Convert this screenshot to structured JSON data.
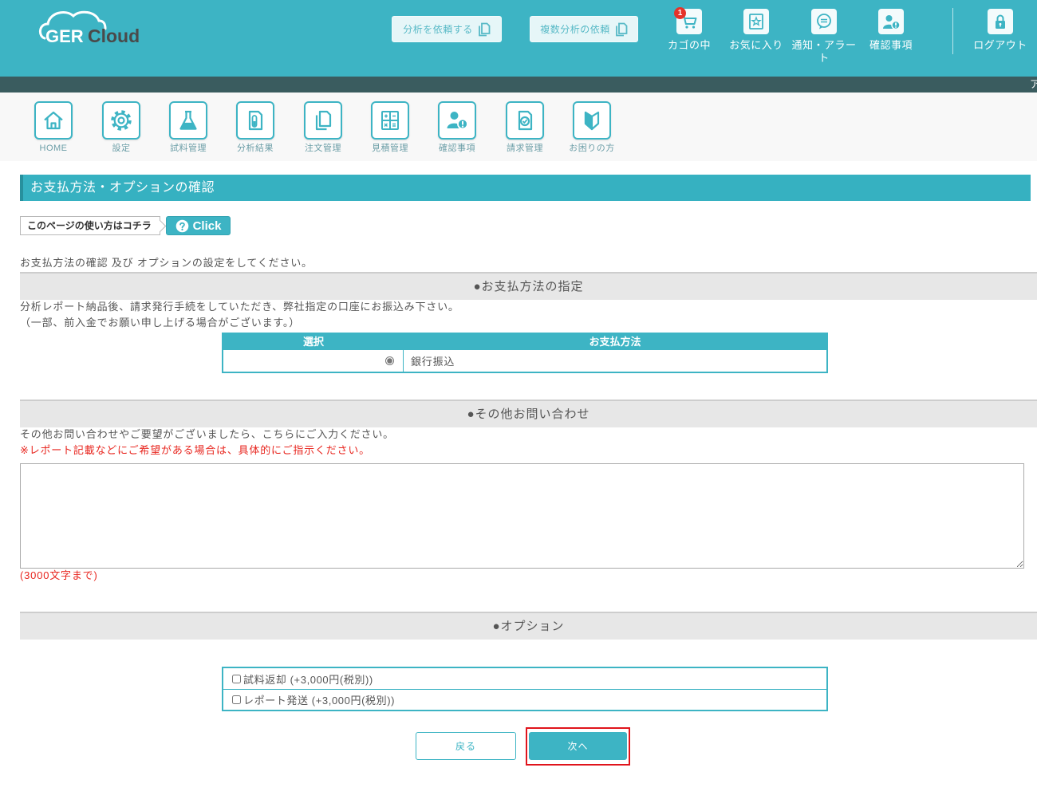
{
  "header": {
    "logo": {
      "part1": "GER",
      "part2": "Cloud"
    },
    "request_button": "分析を依頼する",
    "multi_request_button": "複数分析の依頼",
    "nav": [
      {
        "label": "カゴの中",
        "icon": "cart-icon",
        "badge": "1"
      },
      {
        "label": "お気に入り",
        "icon": "favorite-icon"
      },
      {
        "label": "通知・アラート",
        "icon": "notification-icon"
      },
      {
        "label": "確認事項",
        "icon": "confirm-person-icon"
      }
    ],
    "logout": {
      "label": "ログアウト",
      "icon": "lock-icon"
    }
  },
  "ticker": {
    "text": "ア"
  },
  "menu": [
    {
      "label": "HOME",
      "icon": "home-icon"
    },
    {
      "label": "設定",
      "icon": "gear-icon"
    },
    {
      "label": "試料管理",
      "icon": "flask-icon"
    },
    {
      "label": "分析結果",
      "icon": "test-tube-document-icon"
    },
    {
      "label": "注文管理",
      "icon": "documents-icon"
    },
    {
      "label": "見積管理",
      "icon": "calculator-icon"
    },
    {
      "label": "確認事項",
      "icon": "confirm-person-icon"
    },
    {
      "label": "請求管理",
      "icon": "invoice-check-icon"
    },
    {
      "label": "お困りの方",
      "icon": "beginner-mark-icon"
    }
  ],
  "page": {
    "title": "お支払方法・オプションの確認",
    "help_label": "このページの使い方はコチラ",
    "help_button": "Click",
    "intro": "お支払方法の確認 及び オプションの設定をしてください。"
  },
  "payment": {
    "heading": "●お支払方法の指定",
    "note1": "分析レポート納品後、請求発行手続をしていただき、弊社指定の口座にお振込み下さい。",
    "note2": "（一部、前入金でお願い申し上げる場合がございます。）",
    "table": {
      "headers": [
        "選択",
        "お支払方法"
      ],
      "rows": [
        {
          "selected": true,
          "method": "銀行振込"
        }
      ]
    }
  },
  "inquiry": {
    "heading": "●その他お問い合わせ",
    "note": "その他お問い合わせやご要望がございましたら、こちらにご入力ください。",
    "warning": "※レポート記載などにご希望がある場合は、具体的にご指示ください。",
    "value": "",
    "limit": "(3000文字まで)"
  },
  "options": {
    "heading": "●オプション",
    "items": [
      {
        "label": "試料返却 (+3,000円(税別))",
        "checked": false
      },
      {
        "label": "レポート発送 (+3,000円(税別))",
        "checked": false
      }
    ]
  },
  "actions": {
    "back": "戻る",
    "next": "次へ"
  },
  "colors": {
    "primary": "#3db4c4",
    "ticker_bar": "#3a5c5f",
    "warning_text": "#e8261f",
    "highlight_frame": "#e0141c",
    "badge": "#e5332a"
  }
}
